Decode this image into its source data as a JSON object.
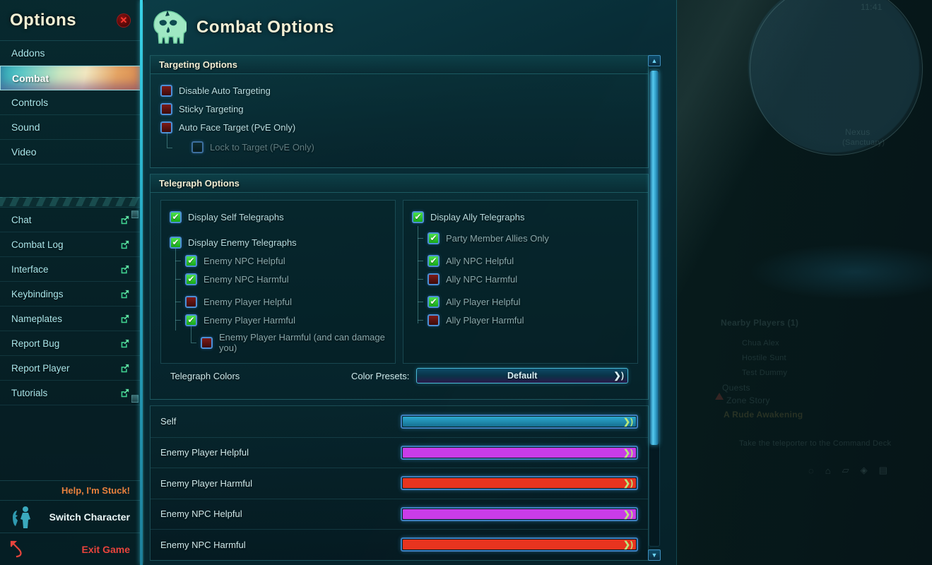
{
  "sidebar": {
    "title": "Options",
    "close_icon": "close-icon",
    "nav_items": [
      {
        "label": "Addons",
        "active": false
      },
      {
        "label": "Combat",
        "active": true
      },
      {
        "label": "Controls",
        "active": false
      },
      {
        "label": "Sound",
        "active": false
      },
      {
        "label": "Video",
        "active": false
      }
    ],
    "link_items": [
      {
        "label": "Chat",
        "icon": "external-link-icon"
      },
      {
        "label": "Combat Log",
        "icon": "external-link-icon"
      },
      {
        "label": "Interface",
        "icon": "external-link-icon"
      },
      {
        "label": "Keybindings",
        "icon": "external-link-icon"
      },
      {
        "label": "Nameplates",
        "icon": "external-link-icon"
      },
      {
        "label": "Report Bug",
        "icon": "external-link-icon"
      },
      {
        "label": "Report Player",
        "icon": "external-link-icon"
      },
      {
        "label": "Tutorials",
        "icon": "external-link-icon"
      }
    ],
    "actions": {
      "stuck": "Help, I'm Stuck!",
      "switch_character": "Switch Character",
      "exit_game": "Exit Game"
    }
  },
  "main": {
    "icon": "skull-icon",
    "title": "Combat Options",
    "sections": {
      "targeting": {
        "header": "Targeting Options",
        "options": [
          {
            "label": "Disable Auto Targeting",
            "checked": false,
            "indent": 0,
            "disabled": false
          },
          {
            "label": "Sticky Targeting",
            "checked": false,
            "indent": 0,
            "disabled": false
          },
          {
            "label": "Auto Face Target (PvE Only)",
            "checked": false,
            "indent": 0,
            "disabled": false
          },
          {
            "label": "Lock to Target (PvE Only)",
            "checked": false,
            "indent": 1,
            "disabled": true
          }
        ]
      },
      "telegraph": {
        "header": "Telegraph Options",
        "left_column": [
          {
            "label": "Display Self Telegraphs",
            "checked": true,
            "indent": 0
          },
          {
            "label": "Display Enemy Telegraphs",
            "checked": true,
            "indent": 0
          },
          {
            "label": "Enemy NPC Helpful",
            "checked": true,
            "indent": 1
          },
          {
            "label": "Enemy NPC Harmful",
            "checked": true,
            "indent": 1
          },
          {
            "label": "Enemy Player Helpful",
            "checked": false,
            "indent": 1
          },
          {
            "label": "Enemy Player Harmful",
            "checked": true,
            "indent": 1
          },
          {
            "label": "Enemy Player Harmful (and can damage you)",
            "checked": false,
            "indent": 2
          }
        ],
        "right_column": [
          {
            "label": "Display Ally Telegraphs",
            "checked": true,
            "indent": 0
          },
          {
            "label": "Party Member Allies Only",
            "checked": true,
            "indent": 1
          },
          {
            "label": "Ally NPC Helpful",
            "checked": true,
            "indent": 1
          },
          {
            "label": "Ally NPC Harmful",
            "checked": false,
            "indent": 1
          },
          {
            "label": "Ally Player Helpful",
            "checked": true,
            "indent": 1
          },
          {
            "label": "Ally Player Harmful",
            "checked": false,
            "indent": 1
          }
        ]
      },
      "telegraph_colors": {
        "title": "Telegraph Colors",
        "presets_label": "Color Presets:",
        "preset_value": "Default",
        "rows": [
          {
            "label": "Self",
            "color": "#1f93b8"
          },
          {
            "label": "Enemy Player Helpful",
            "color": "#c93ce8"
          },
          {
            "label": "Enemy Player Harmful",
            "color": "#e8341f"
          },
          {
            "label": "Enemy NPC Helpful",
            "color": "#c93ce8"
          },
          {
            "label": "Enemy NPC Harmful",
            "color": "#e8341f"
          }
        ]
      }
    },
    "scrollbar": {
      "up_icon": "chevron-up-icon",
      "down_icon": "chevron-down-icon"
    }
  },
  "game_background": {
    "minimap_time": "11:41",
    "minimap_zone": "Nexus",
    "minimap_subzone": "(Sanctuary)",
    "tracker": {
      "nearby_players": "Nearby Players (1)",
      "entries": [
        "Chua Alex",
        "Hostile Sunt",
        "Test Dummy"
      ],
      "quests_label": "Quests",
      "zone_story_label": "Zone Story",
      "quest_title": "A Rude Awakening",
      "quest_objective": "Take the teleporter to the Command Deck"
    }
  }
}
